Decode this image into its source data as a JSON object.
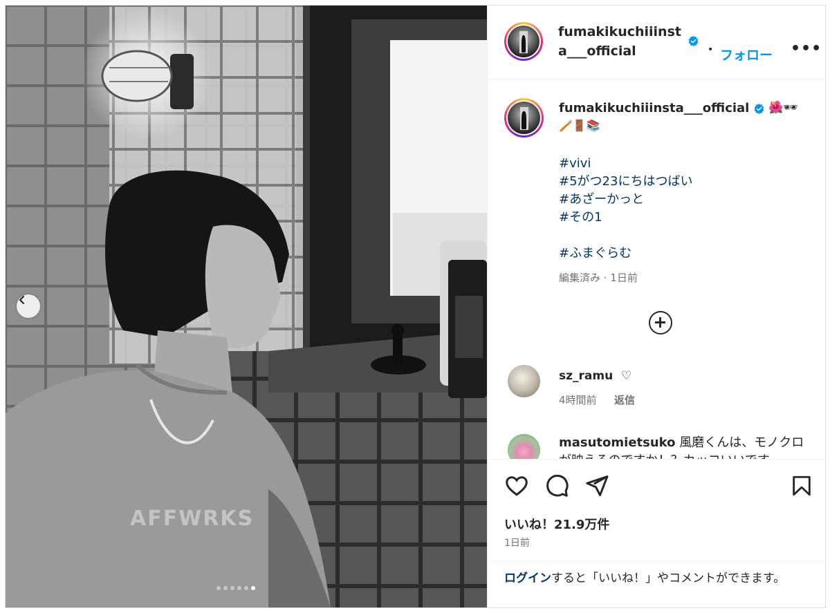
{
  "post": {
    "username": "fumakikuchiiinsta___official",
    "follow_label": "フォロー",
    "separator": "•",
    "more_label": "•••"
  },
  "caption": {
    "username": "fumakikuchiiinsta___official",
    "emoji_line1": "🌺🕶",
    "emoji_line2": "🪥🚪📚",
    "hashtags_group1": [
      "#vivi",
      "#5がつ23にちはつばい",
      "#あざーかっと",
      "#その1"
    ],
    "hashtags_group2": [
      "#ふまぐらむ"
    ],
    "meta": "編集済み · 1日前"
  },
  "comments": [
    {
      "username": "sz_ramu",
      "text": "♡",
      "time": "4時間前",
      "reply_label": "返信"
    },
    {
      "username": "masutomietsuko",
      "text": "風磨くんは、モノクロが映えるのですか！？カッコいいです"
    }
  ],
  "actions": {
    "likes": "いいね！21.9万件",
    "time": "1日前"
  },
  "login_prompt": {
    "link": "ログイン",
    "text": "すると「いいね！」やコメントができます。"
  },
  "photo": {
    "shirt_text": "AFFWRKS",
    "carousel_total": 6,
    "carousel_active": 6
  },
  "colors": {
    "accent": "#0095f6",
    "link": "#00376b",
    "secondary_text": "#737373",
    "border": "#dbdbdb"
  }
}
